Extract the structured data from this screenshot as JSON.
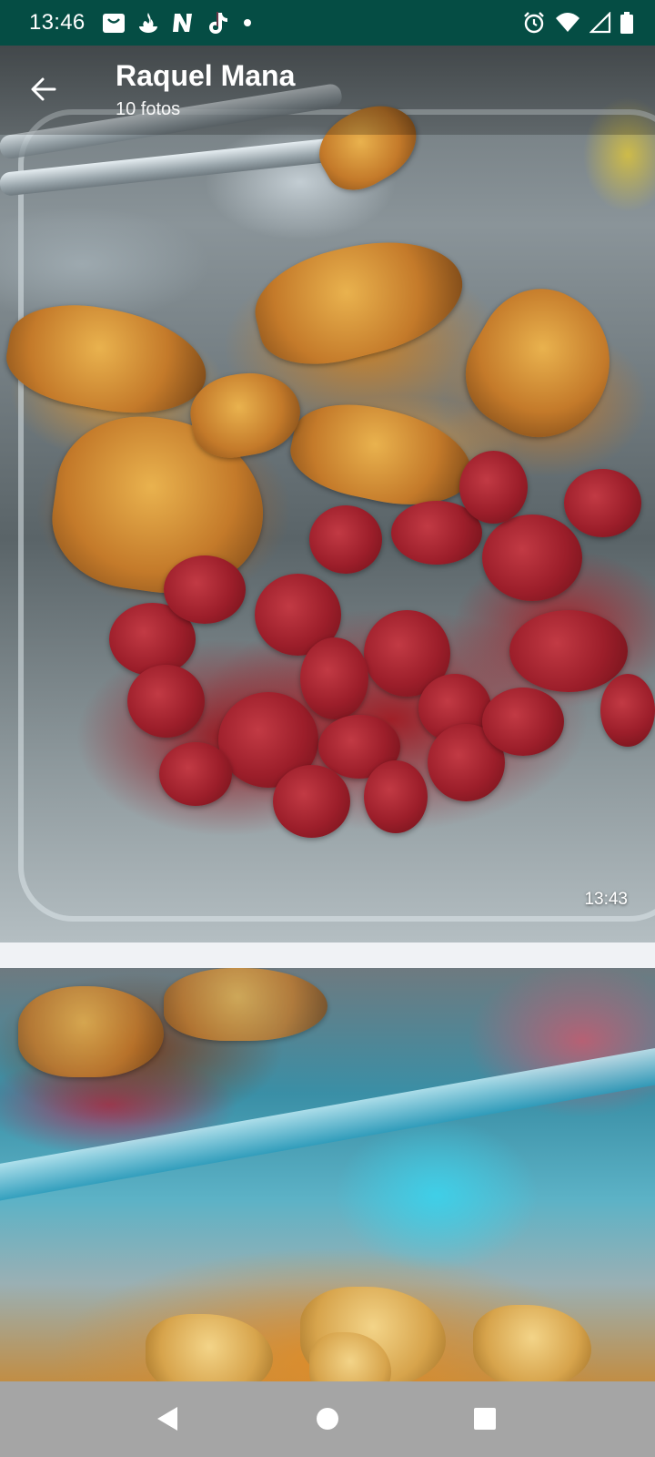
{
  "status_bar": {
    "time": "13:46",
    "left_icons": [
      "bag-icon",
      "santander-icon",
      "netflix-icon",
      "tiktok-icon",
      "notification-dot-icon"
    ],
    "right_icons": [
      "alarm-icon",
      "wifi-icon",
      "signal-icon",
      "battery-icon"
    ]
  },
  "header": {
    "title": "Raquel Mana",
    "subtitle": "10 fotos",
    "back_icon": "arrow-back-icon"
  },
  "photos": [
    {
      "timestamp": "13:43",
      "description_icon": "photo-chicken-sausage"
    },
    {
      "timestamp": "",
      "description_icon": "photo-fish-stew"
    }
  ],
  "colors": {
    "status_bar": "#054d44",
    "nav_bar": "#a5a5a5",
    "background": "#f0f2f5"
  },
  "nav": {
    "buttons": [
      "back-triangle-icon",
      "home-circle-icon",
      "recents-square-icon"
    ]
  }
}
